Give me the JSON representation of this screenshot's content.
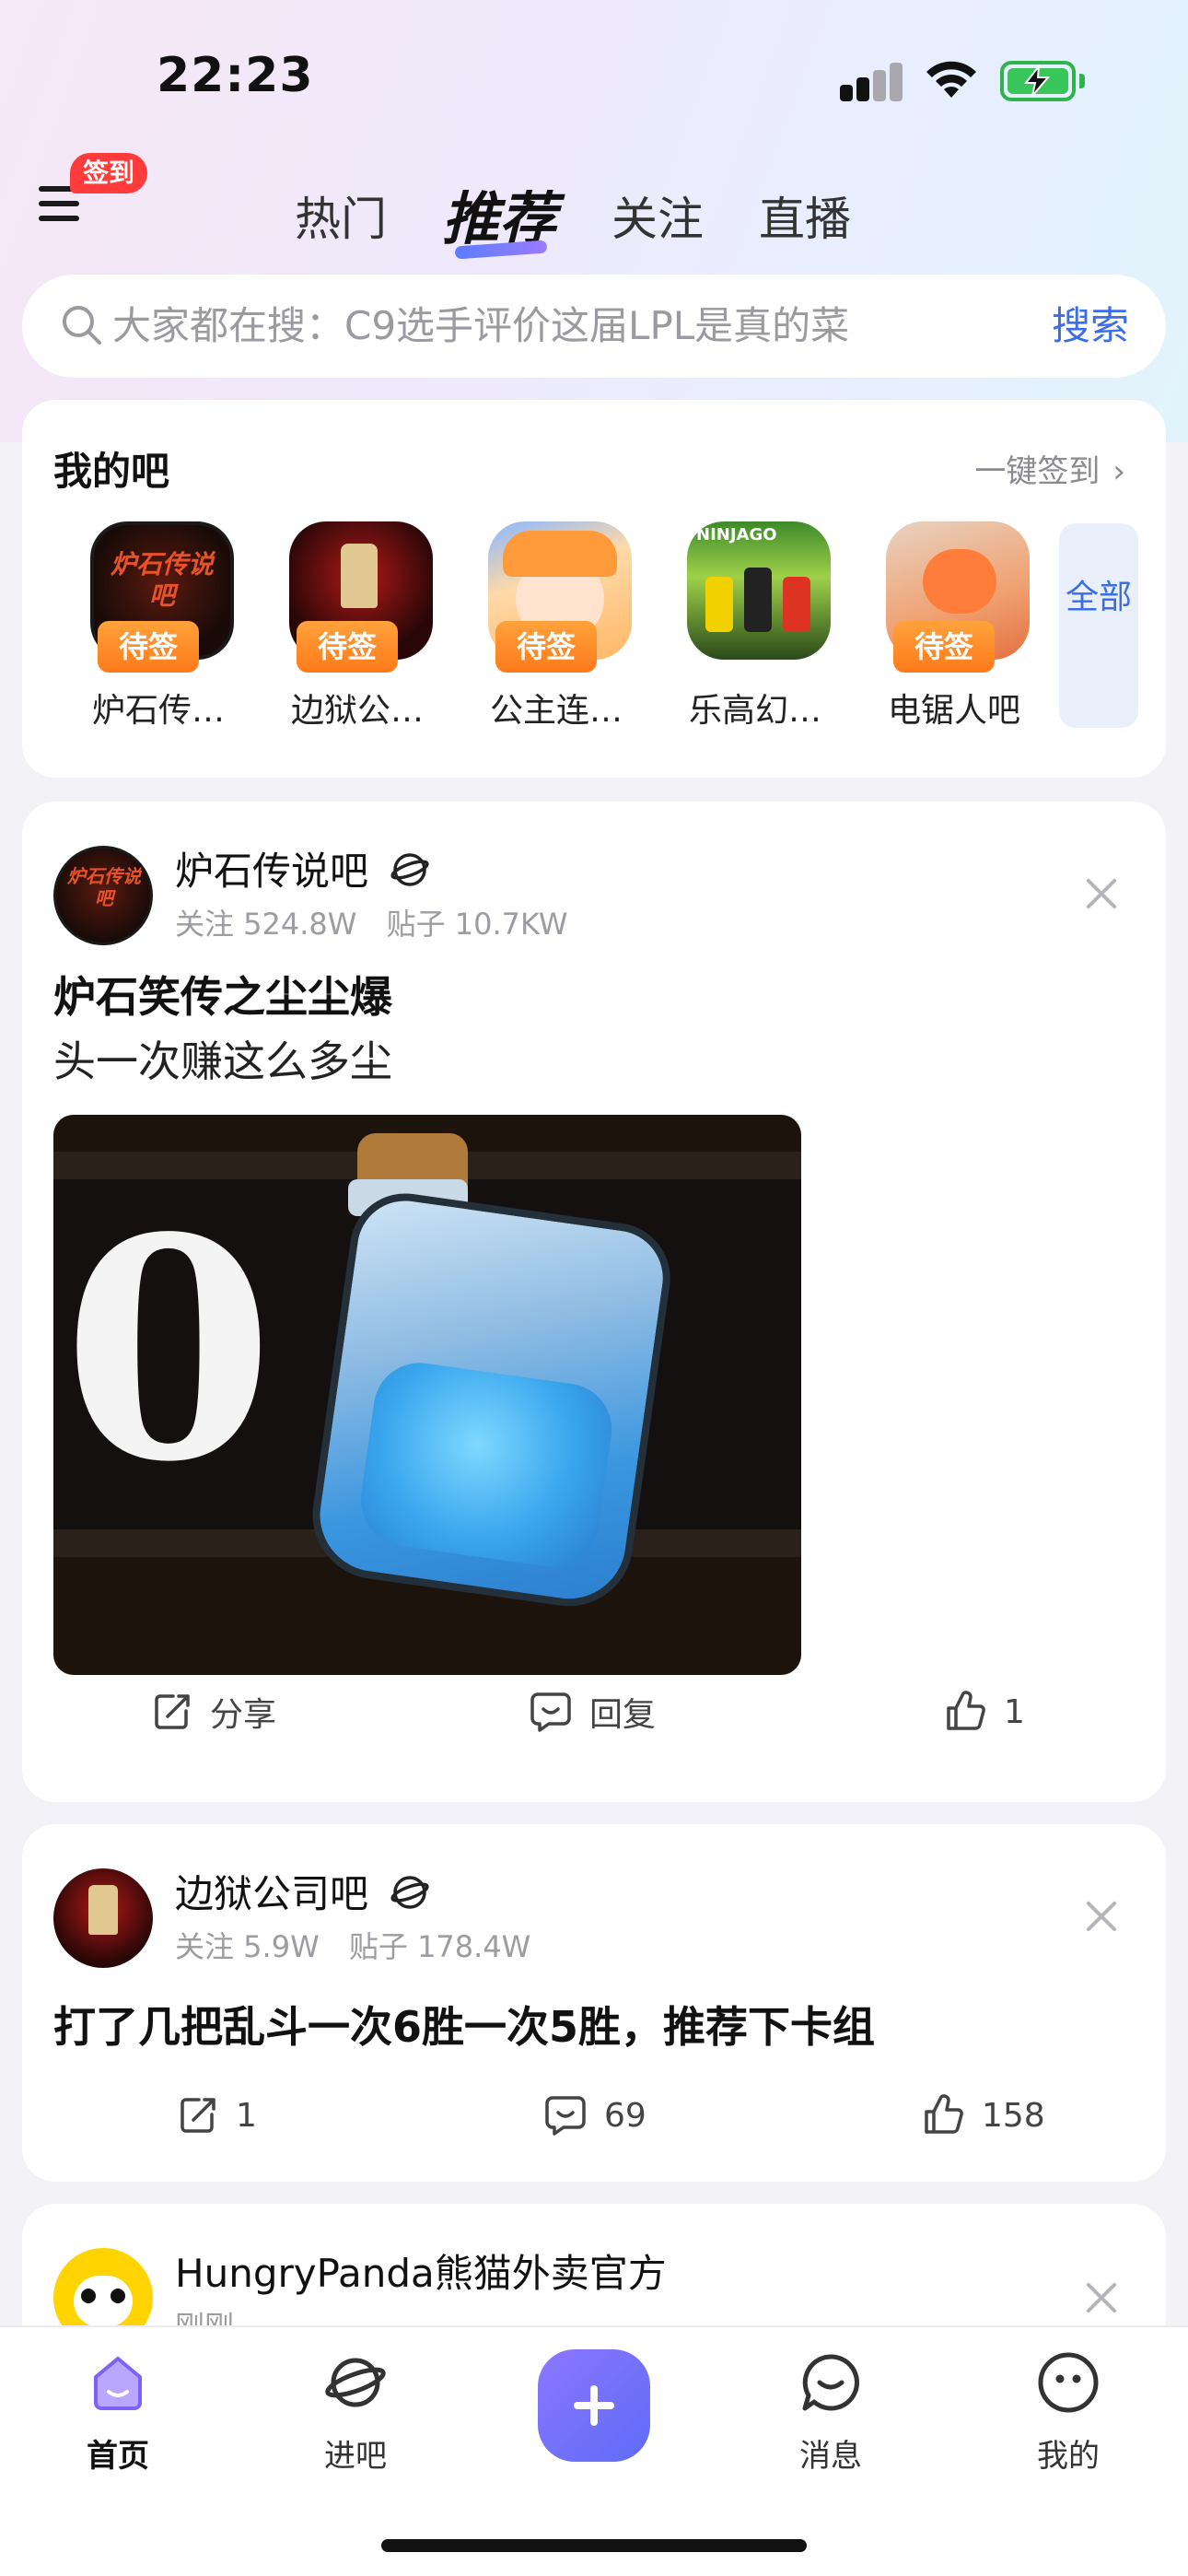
{
  "status_bar": {
    "time": "22:23"
  },
  "header": {
    "signin_badge": "签到",
    "tabs": [
      {
        "label": "热门",
        "active": false
      },
      {
        "label": "推荐",
        "active": true
      },
      {
        "label": "关注",
        "active": false
      },
      {
        "label": "直播",
        "active": false
      }
    ]
  },
  "search": {
    "placeholder": "大家都在搜：C9选手评价这届LPL是真的菜",
    "button": "搜索"
  },
  "my_bars": {
    "title": "我的吧",
    "sign_all": "一键签到",
    "all_button": "全部",
    "forums": [
      {
        "name": "炉石传…",
        "tag": "待签",
        "avatar_text": "炉石传说吧"
      },
      {
        "name": "边狱公…",
        "tag": "待签"
      },
      {
        "name": "公主连…",
        "tag": "待签"
      },
      {
        "name": "乐高幻…",
        "tag": "",
        "avatar_text": "NINJAGO"
      },
      {
        "name": "电锯人吧",
        "tag": "待签"
      }
    ]
  },
  "posts": [
    {
      "forum": "炉石传说吧",
      "followers": "关注 524.8W",
      "posts_count": "贴子 10.7KW",
      "title": "炉石笑传之尘尘爆",
      "body": "头一次赚这么多尘",
      "image_digit": "0",
      "actions": {
        "share": "分享",
        "reply": "回复",
        "like": "1"
      }
    },
    {
      "forum": "边狱公司吧",
      "followers": "关注 5.9W",
      "posts_count": "贴子 178.4W",
      "title": "打了几把乱斗一次6胜一次5胜，推荐下卡组",
      "actions": {
        "share": "1",
        "reply": "69",
        "like": "158"
      }
    },
    {
      "forum": "HungryPanda熊猫外卖官方",
      "time": "刚刚"
    }
  ],
  "tab_bar": {
    "items": [
      {
        "label": "首页",
        "active": true
      },
      {
        "label": "进吧",
        "active": false
      },
      {
        "label": "消息",
        "active": false
      },
      {
        "label": "我的",
        "active": false
      }
    ]
  },
  "colors": {
    "accent": "#3b6de8",
    "badge_red": "#ff3b3b",
    "sign_orange": "#ff8a26",
    "fab_purple": "#7a72fb"
  }
}
